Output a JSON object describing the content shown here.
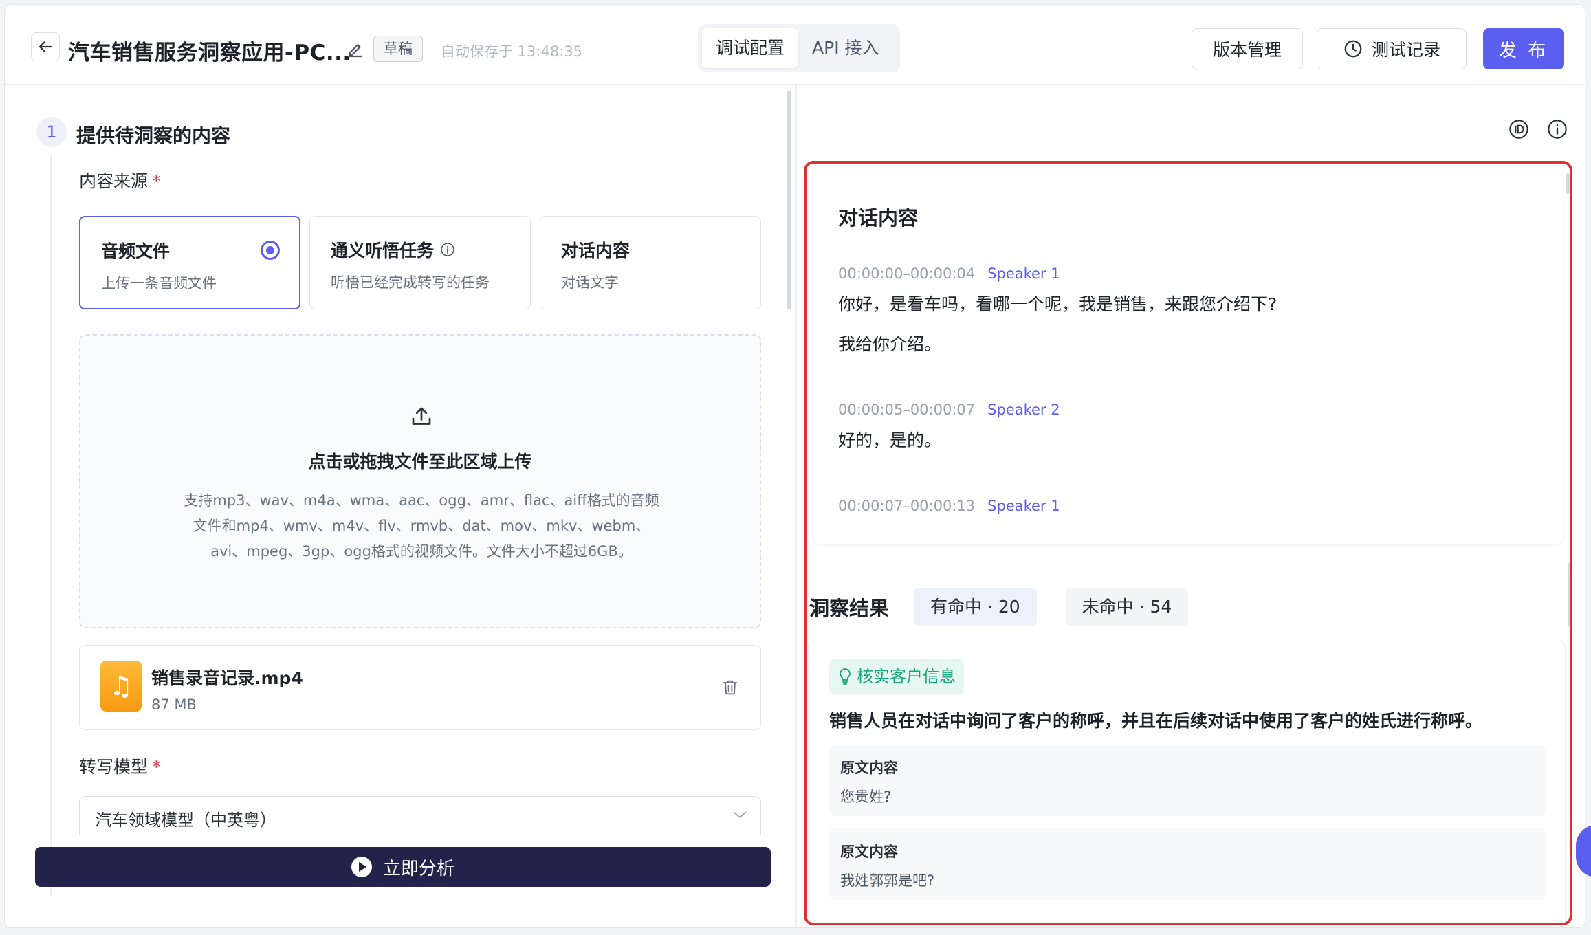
{
  "header": {
    "title": "汽车销售服务洞察应用-PC...",
    "draft_badge": "草稿",
    "autosave": "自动保存于 13:48:35",
    "tabs": [
      {
        "label": "调试配置",
        "active": true
      },
      {
        "label": "API 接入",
        "active": false
      }
    ],
    "version_btn": "版本管理",
    "test_record_btn": "测试记录",
    "publish_btn": "发 布"
  },
  "left": {
    "step_number": "1",
    "step_title": "提供待洞察的内容",
    "source_label": "内容来源",
    "required_mark": "*",
    "source_options": [
      {
        "title": "音频文件",
        "desc": "上传一条音频文件",
        "selected": true
      },
      {
        "title": "通义听悟任务",
        "desc": "听悟已经完成转写的任务",
        "selected": false
      },
      {
        "title": "对话内容",
        "desc": "对话文字",
        "selected": false
      }
    ],
    "upload": {
      "title": "点击或拖拽文件至此区域上传",
      "desc": "支持mp3、wav、m4a、wma、aac、ogg、amr、flac、aiff格式的音频文件和mp4、wmv、m4v、flv、rmvb、dat、mov、mkv、webm、avi、mpeg、3gp、ogg格式的视频文件。文件大小不超过6GB。"
    },
    "file": {
      "name": "销售录音记录.mp4",
      "size": "87 MB"
    },
    "model_label": "转写模型",
    "model_value": "汽车领域模型（中英粤）",
    "analyze_btn": "立即分析"
  },
  "right": {
    "dialog_title": "对话内容",
    "segments": [
      {
        "time": "00:00:00–00:00:04",
        "speaker": "Speaker 1",
        "lines": [
          "你好，是看车吗，看哪一个呢，我是销售，来跟您介绍下?",
          "我给你介绍。"
        ]
      },
      {
        "time": "00:00:05–00:00:07",
        "speaker": "Speaker 2",
        "lines": [
          "好的，是的。"
        ]
      },
      {
        "time": "00:00:07–00:00:13",
        "speaker": "Speaker 1",
        "lines": []
      }
    ],
    "insight_title": "洞察结果",
    "hit_pill": "有命中 · 20",
    "miss_pill": "未命中 · 54",
    "insight": {
      "tag": "核实客户信息",
      "desc": "销售人员在对话中询问了客户的称呼，并且在后续对话中使用了客户的姓氏进行称呼。",
      "quotes": [
        {
          "label": "原文内容",
          "text": "您贵姓?"
        },
        {
          "label": "原文内容",
          "text": "我姓郭郭是吧?"
        }
      ]
    }
  },
  "colors": {
    "accent": "#5b5ff0",
    "highlight_border": "#e03131",
    "analyze_bg": "#21234a",
    "tag_green": "#14a57a"
  },
  "icons": [
    "back-arrow-icon",
    "edit-pencil-icon",
    "clock-icon",
    "id-icon",
    "info-icon",
    "upload-icon",
    "music-file-icon",
    "trash-icon",
    "chevron-down-icon",
    "play-icon",
    "lightbulb-icon"
  ]
}
